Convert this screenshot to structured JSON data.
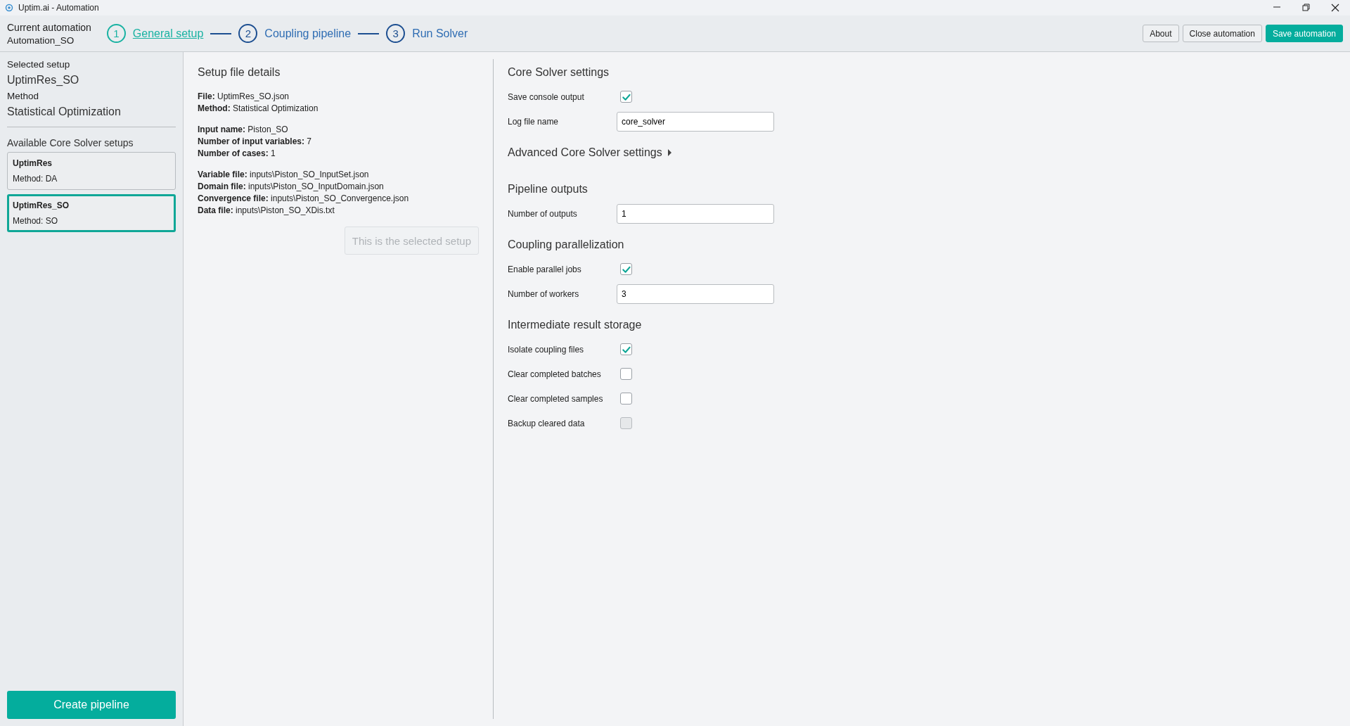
{
  "window": {
    "title": "Uptim.ai - Automation"
  },
  "header": {
    "label": "Current automation",
    "name": "Automation_SO",
    "steps": [
      {
        "number": "1",
        "label": "General setup",
        "selected": true
      },
      {
        "number": "2",
        "label": "Coupling pipeline",
        "selected": false
      },
      {
        "number": "3",
        "label": "Run Solver",
        "selected": false
      }
    ],
    "buttons": [
      {
        "label": "About",
        "kind": "outline"
      },
      {
        "label": "Close automation",
        "kind": "outline"
      },
      {
        "label": "Save automation",
        "kind": "primary"
      }
    ]
  },
  "sidebar": {
    "selected_label": "Selected setup",
    "selected_name": "UptimRes_SO",
    "method_label": "Method",
    "method_name": "Statistical Optimization",
    "list_title": "Available Core Solver setups",
    "setups": [
      {
        "name": "UptimRes",
        "method": "Method: DA",
        "selected": false
      },
      {
        "name": "UptimRes_SO",
        "method": "Method: SO",
        "selected": true
      }
    ],
    "action": "Create pipeline"
  },
  "details": {
    "title": "Setup file details",
    "groups": [
      [
        {
          "label": "File:",
          "value": "UptimRes_SO.json"
        },
        {
          "label": "Method:",
          "value": "Statistical Optimization"
        }
      ],
      [
        {
          "label": "Input name:",
          "value": "Piston_SO"
        },
        {
          "label": "Number of input variables:",
          "value": "7"
        },
        {
          "label": "Number of cases:",
          "value": "1"
        }
      ],
      [
        {
          "label": "Variable file:",
          "value": "inputs\\Piston_SO_InputSet.json"
        },
        {
          "label": "Domain file:",
          "value": "inputs\\Piston_SO_InputDomain.json"
        },
        {
          "label": "Convergence file:",
          "value": "inputs\\Piston_SO_Convergence.json"
        },
        {
          "label": "Data file:",
          "value": "inputs\\Piston_SO_XDis.txt"
        }
      ]
    ],
    "button": {
      "label": "This is the selected setup",
      "disabled": true
    }
  },
  "settings": {
    "sections": [
      {
        "title": "Core Solver settings",
        "rows": [
          {
            "kind": "checkbox",
            "label": "Save console output",
            "checked": true,
            "disabled": false
          },
          {
            "kind": "input",
            "label": "Log file name",
            "value": "core_solver"
          }
        ]
      },
      {
        "kind": "expander",
        "title": "Advanced Core Solver settings",
        "expanded": false
      },
      {
        "title": "Pipeline outputs",
        "rows": [
          {
            "kind": "input",
            "label": "Number of outputs",
            "value": "1"
          }
        ]
      },
      {
        "title": "Coupling parallelization",
        "rows": [
          {
            "kind": "checkbox",
            "label": "Enable parallel jobs",
            "checked": true,
            "disabled": false
          },
          {
            "kind": "input",
            "label": "Number of workers",
            "value": "3"
          }
        ]
      },
      {
        "title": "Intermediate result storage",
        "rows": [
          {
            "kind": "checkbox",
            "label": "Isolate coupling files",
            "checked": true,
            "disabled": false
          },
          {
            "kind": "checkbox",
            "label": "Clear completed batches",
            "checked": false,
            "disabled": false
          },
          {
            "kind": "checkbox",
            "label": "Clear completed samples",
            "checked": false,
            "disabled": false
          },
          {
            "kind": "checkbox",
            "label": "Backup cleared data",
            "checked": false,
            "disabled": true
          }
        ]
      }
    ]
  }
}
